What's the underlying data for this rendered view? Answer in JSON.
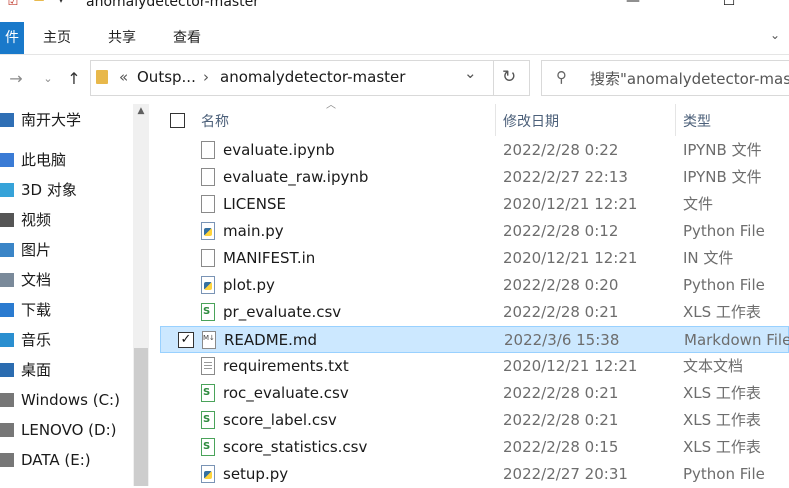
{
  "window": {
    "title": "anomalydetector-master",
    "buttons": {
      "minimize": "—",
      "maximize": "☐",
      "close": "✕"
    }
  },
  "ribbon": {
    "file_tab": "件",
    "tabs": [
      "主页",
      "共享",
      "查看"
    ],
    "expand_icon": "chevron-down-icon"
  },
  "address": {
    "overflow": "«",
    "crumbs": [
      "Outsp...",
      "anomalydetector-master"
    ],
    "separator": "›",
    "dropdown": "⌄",
    "refresh": "↻"
  },
  "search": {
    "placeholder": "搜索\"anomalydetector-mas"
  },
  "nav": {
    "items": [
      {
        "label": "南开大学",
        "icon": "onedrive-folder-icon"
      },
      {
        "label": "此电脑",
        "icon": "computer-icon"
      },
      {
        "label": "3D 对象",
        "icon": "3d-objects-icon"
      },
      {
        "label": "视频",
        "icon": "video-icon"
      },
      {
        "label": "图片",
        "icon": "pictures-icon"
      },
      {
        "label": "文档",
        "icon": "documents-icon"
      },
      {
        "label": "下载",
        "icon": "downloads-icon"
      },
      {
        "label": "音乐",
        "icon": "music-icon"
      },
      {
        "label": "桌面",
        "icon": "desktop-icon"
      },
      {
        "label": "Windows (C:)",
        "icon": "drive-icon"
      },
      {
        "label": "LENOVO (D:)",
        "icon": "drive-icon"
      },
      {
        "label": "DATA (E:)",
        "icon": "drive-icon"
      }
    ]
  },
  "list": {
    "columns": {
      "name": "名称",
      "date": "修改日期",
      "type": "类型"
    },
    "rows": [
      {
        "name": "evaluate.ipynb",
        "date": "2022/2/28 0:22",
        "type": "IPYNB 文件",
        "icon": "file"
      },
      {
        "name": "evaluate_raw.ipynb",
        "date": "2022/2/27 22:13",
        "type": "IPYNB 文件",
        "icon": "file"
      },
      {
        "name": "LICENSE",
        "date": "2020/12/21 12:21",
        "type": "文件",
        "icon": "file"
      },
      {
        "name": "main.py",
        "date": "2022/2/28 0:12",
        "type": "Python File",
        "icon": "py"
      },
      {
        "name": "MANIFEST.in",
        "date": "2020/12/21 12:21",
        "type": "IN 文件",
        "icon": "file"
      },
      {
        "name": "plot.py",
        "date": "2022/2/28 0:20",
        "type": "Python File",
        "icon": "py"
      },
      {
        "name": "pr_evaluate.csv",
        "date": "2022/2/28 0:21",
        "type": "XLS 工作表",
        "icon": "csv"
      },
      {
        "name": "README.md",
        "date": "2022/3/6 15:38",
        "type": "Markdown File",
        "icon": "md",
        "selected": true
      },
      {
        "name": "requirements.txt",
        "date": "2020/12/21 12:21",
        "type": "文本文档",
        "icon": "txt"
      },
      {
        "name": "roc_evaluate.csv",
        "date": "2022/2/28 0:21",
        "type": "XLS 工作表",
        "icon": "csv"
      },
      {
        "name": "score_label.csv",
        "date": "2022/2/28 0:21",
        "type": "XLS 工作表",
        "icon": "csv"
      },
      {
        "name": "score_statistics.csv",
        "date": "2022/2/28 0:15",
        "type": "XLS 工作表",
        "icon": "csv"
      },
      {
        "name": "setup.py",
        "date": "2022/2/27 20:31",
        "type": "Python File",
        "icon": "py"
      }
    ]
  },
  "colors": {
    "accent": "#1979ca",
    "selection_bg": "#cce8ff",
    "selection_border": "#99d1ff",
    "header_text": "#4c607a"
  }
}
